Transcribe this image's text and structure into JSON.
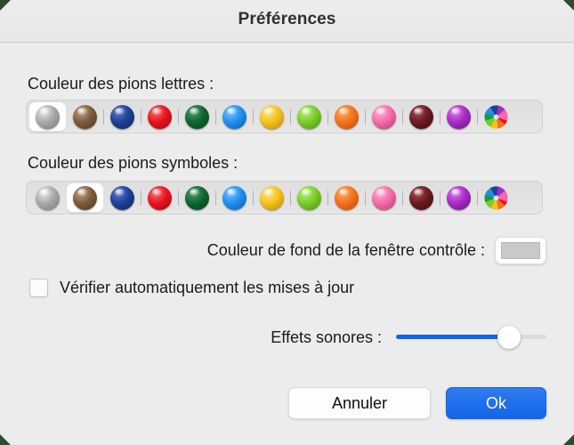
{
  "window": {
    "title": "Préférences",
    "background": "#ececec",
    "titlebar_background": "#ededed"
  },
  "sections": {
    "letters": {
      "label": "Couleur des pions lettres :",
      "selected_index": 0
    },
    "symbols": {
      "label": "Couleur des pions symboles :",
      "selected_index": 1
    }
  },
  "swatches": [
    {
      "name": "gray",
      "color": "#a8a8a8",
      "light": "#e8e8e8",
      "dark": "#7a7a7a"
    },
    {
      "name": "brown",
      "color": "#7d5a3c",
      "light": "#c0a188",
      "dark": "#4d3522"
    },
    {
      "name": "blue",
      "color": "#1f3f95",
      "light": "#5c7bd0",
      "dark": "#10235c"
    },
    {
      "name": "red",
      "color": "#e8121e",
      "light": "#ff6b6b",
      "dark": "#9c0710"
    },
    {
      "name": "green",
      "color": "#10652f",
      "light": "#4fa068",
      "dark": "#073d1b"
    },
    {
      "name": "light-blue",
      "color": "#1f8ff0",
      "light": "#79c4ff",
      "dark": "#0c5aa8"
    },
    {
      "name": "yellow",
      "color": "#f5c21a",
      "light": "#ffe488",
      "dark": "#b88906"
    },
    {
      "name": "light-green",
      "color": "#79cc2a",
      "light": "#bdf07b",
      "dark": "#4d8d12"
    },
    {
      "name": "orange",
      "color": "#f5711a",
      "light": "#ffab68",
      "dark": "#b34a06"
    },
    {
      "name": "pink",
      "color": "#f56aa8",
      "light": "#ffb3d2",
      "dark": "#b53a72"
    },
    {
      "name": "dark-red",
      "color": "#6b1a1f",
      "light": "#a35057",
      "dark": "#3d0a0e"
    },
    {
      "name": "purple",
      "color": "#a62bc4",
      "light": "#d97ceb",
      "dark": "#6b1080"
    },
    {
      "name": "rainbow",
      "color": "rainbow",
      "light": "",
      "dark": ""
    }
  ],
  "background_color_row": {
    "label": "Couleur de fond de la fenêtre contrôle :",
    "swatch_color": "#c9c9c9"
  },
  "auto_update": {
    "label": "Vérifier automatiquement les mises à jour",
    "checked": false
  },
  "sound_effects": {
    "label": "Effets sonores :",
    "value_percent": 75,
    "fill_color": "#1064ea"
  },
  "footer": {
    "cancel_label": "Annuler",
    "ok_label": "Ok",
    "ok_color": "#1464e8"
  }
}
